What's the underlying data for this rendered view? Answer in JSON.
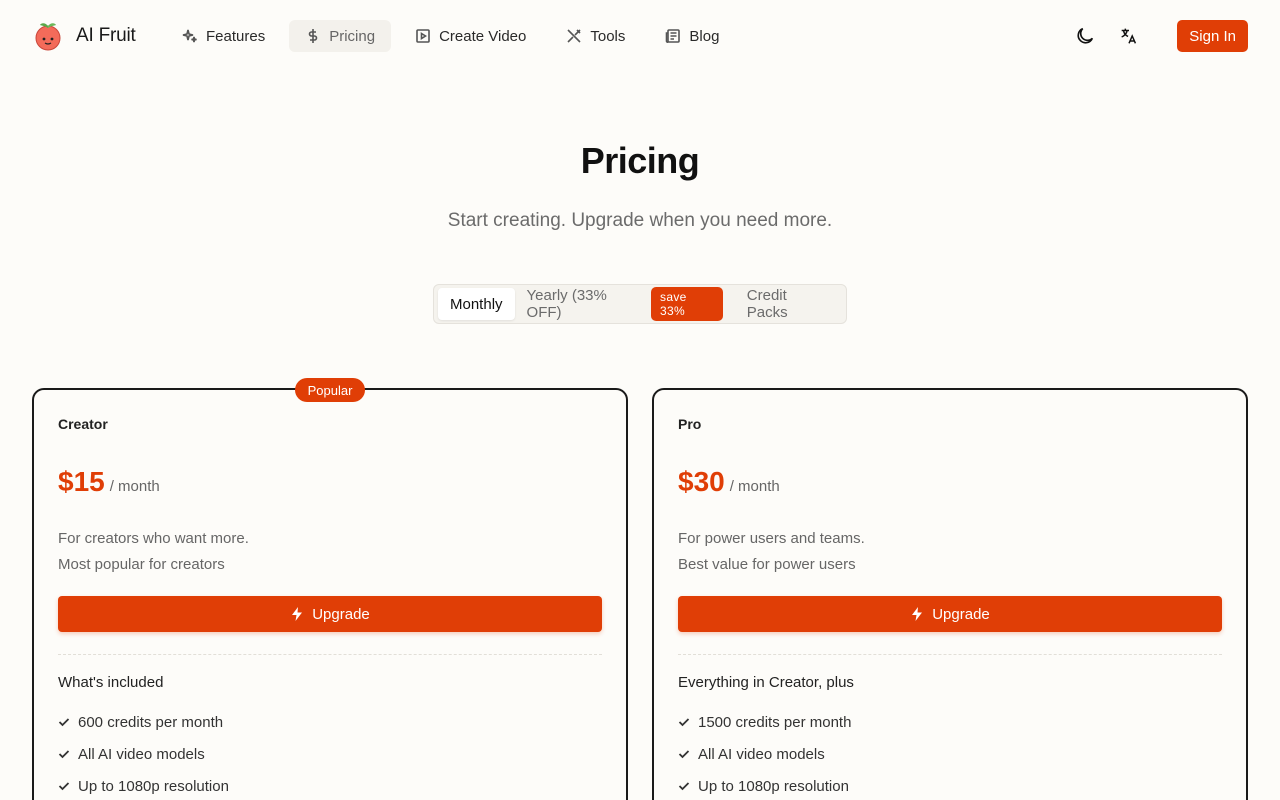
{
  "brand": {
    "name": "AI Fruit"
  },
  "nav": {
    "items": [
      {
        "label": "Features",
        "icon": "sparkles-icon"
      },
      {
        "label": "Pricing",
        "icon": "dollar-icon"
      },
      {
        "label": "Create Video",
        "icon": "play-square-icon"
      },
      {
        "label": "Tools",
        "icon": "tools-icon"
      },
      {
        "label": "Blog",
        "icon": "newspaper-icon"
      }
    ],
    "active": "Pricing",
    "sign_in": "Sign In"
  },
  "hero": {
    "title": "Pricing",
    "subtitle": "Start creating. Upgrade when you need more."
  },
  "billing_toggle": {
    "monthly": "Monthly",
    "yearly": "Yearly (33% OFF)",
    "save_badge": "save 33%",
    "credit_packs": "Credit Packs",
    "selected": "Monthly"
  },
  "plans": [
    {
      "badge": "Popular",
      "name": "Creator",
      "price": "$15",
      "period": "/ month",
      "desc_1": "For creators who want more.",
      "desc_2": "Most popular for creators",
      "cta": "Upgrade",
      "features_title": "What's included",
      "features": [
        "600 credits per month",
        "All AI video models",
        "Up to 1080p resolution"
      ]
    },
    {
      "name": "Pro",
      "price": "$30",
      "period": "/ month",
      "desc_1": "For power users and teams.",
      "desc_2": "Best value for power users",
      "cta": "Upgrade",
      "features_title": "Everything in Creator, plus",
      "features": [
        "1500 credits per month",
        "All AI video models",
        "Up to 1080p resolution"
      ]
    }
  ],
  "colors": {
    "accent": "#e03e06",
    "background": "#fdfcf9",
    "text": "#1a1a1a"
  }
}
